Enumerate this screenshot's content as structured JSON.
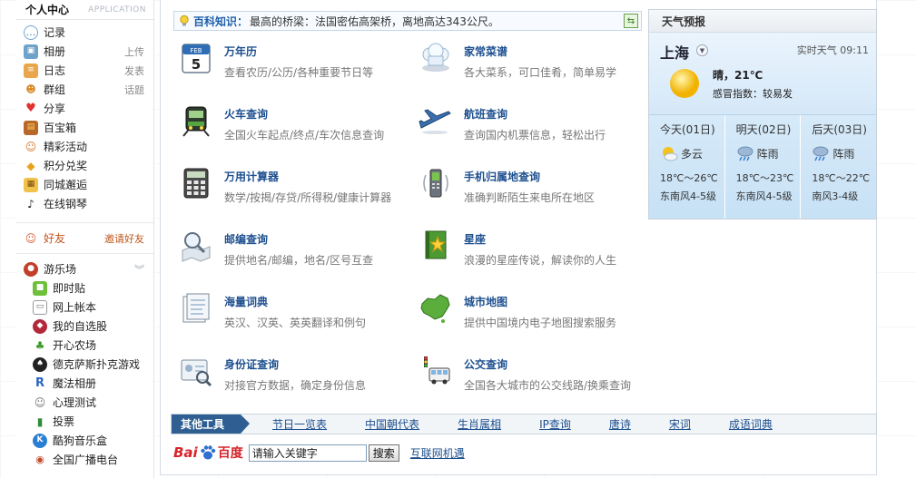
{
  "sidebar": {
    "title": "个人中心",
    "subtitle": "APPLICATION",
    "items": [
      {
        "label": "记录",
        "action": "",
        "icon": "speech-bubble-icon"
      },
      {
        "label": "相册",
        "action": "上传",
        "icon": "photo-icon"
      },
      {
        "label": "日志",
        "action": "发表",
        "icon": "notebook-icon"
      },
      {
        "label": "群组",
        "action": "话题",
        "icon": "group-icon"
      },
      {
        "label": "分享",
        "action": "",
        "icon": "heart-icon"
      },
      {
        "label": "百宝箱",
        "action": "",
        "icon": "treasure-box-icon"
      },
      {
        "label": "精彩活动",
        "action": "",
        "icon": "people-icon"
      },
      {
        "label": "积分兑奖",
        "action": "",
        "icon": "diamond-icon"
      },
      {
        "label": "同城邂逅",
        "action": "",
        "icon": "city-icon"
      },
      {
        "label": "在线钢琴",
        "action": "",
        "icon": "piano-icon"
      }
    ],
    "friends": {
      "label": "好友",
      "action": "邀请好友",
      "icon": "friend-icon"
    },
    "playground": {
      "label": "游乐场",
      "icon": "playground-icon"
    },
    "games": [
      {
        "label": "即时贴",
        "icon": "sticky-note-icon"
      },
      {
        "label": "网上帐本",
        "icon": "ledger-icon"
      },
      {
        "label": "我的自选股",
        "icon": "stock-icon"
      },
      {
        "label": "开心农场",
        "icon": "farm-sprout-icon"
      },
      {
        "label": "德克萨斯扑克游戏",
        "icon": "poker-icon"
      },
      {
        "label": "魔法相册",
        "icon": "magic-album-icon"
      },
      {
        "label": "心理测试",
        "icon": "psych-test-icon"
      },
      {
        "label": "投票",
        "icon": "vote-chart-icon"
      },
      {
        "label": "酷狗音乐盒",
        "icon": "kugou-music-icon"
      },
      {
        "label": "全国广播电台",
        "icon": "radio-icon"
      }
    ]
  },
  "tip": {
    "key": "百科知识：",
    "text": "最高的桥梁：法国密佑高架桥，离地高达343公尺。"
  },
  "tools": [
    {
      "name": "万年历",
      "desc": "查看农历/公历/各种重要节日等",
      "icon": "calendar-icon",
      "cal_month": "FEB",
      "cal_day": "5"
    },
    {
      "name": "家常菜谱",
      "desc": "各大菜系，可口佳肴，简单易学",
      "icon": "chef-hat-icon"
    },
    {
      "name": "火车查询",
      "desc": "全国火车起点/终点/车次信息查询",
      "icon": "train-icon"
    },
    {
      "name": "航班查询",
      "desc": "查询国内机票信息，轻松出行",
      "icon": "airplane-icon"
    },
    {
      "name": "万用计算器",
      "desc": "数学/按揭/存贷/所得税/健康计算器",
      "icon": "calculator-icon"
    },
    {
      "name": "手机归属地查询",
      "desc": "准确判断陌生来电所在地区",
      "icon": "mobile-phone-icon"
    },
    {
      "name": "邮编查询",
      "desc": "提供地名/邮编，地名/区号互查",
      "icon": "magnifier-map-icon"
    },
    {
      "name": "星座",
      "desc": "浪漫的星座传说，解读你的人生",
      "icon": "star-book-icon"
    },
    {
      "name": "海量词典",
      "desc": "英汉、汉英、英英翻译和例句",
      "icon": "dictionary-icon"
    },
    {
      "name": "城市地图",
      "desc": "提供中国境内电子地图搜索服务",
      "icon": "china-map-icon"
    },
    {
      "name": "身份证查询",
      "desc": "对接官方数据，确定身份信息",
      "icon": "id-card-icon"
    },
    {
      "name": "公交查询",
      "desc": "全国各大城市的公交线路/换乘查询",
      "icon": "bus-icon"
    }
  ],
  "weather": {
    "title": "天气预报",
    "city": "上海",
    "realtime_label": "实时天气 09:11",
    "condition": "晴，21℃",
    "feel": "感冒指数：较易发",
    "days": [
      {
        "label": "今天(01日)",
        "cond": "多云",
        "temp": "18℃～26℃",
        "wind": "东南风4-5级",
        "icon": "partly-cloudy-icon"
      },
      {
        "label": "明天(02日)",
        "cond": "阵雨",
        "temp": "18℃～23℃",
        "wind": "东南风4-5级",
        "icon": "shower-icon"
      },
      {
        "label": "后天(03日)",
        "cond": "阵雨",
        "temp": "18℃～22℃",
        "wind": "南风3-4级",
        "icon": "shower-icon"
      }
    ]
  },
  "tabs": {
    "first": "其他工具",
    "links": [
      "节日一览表",
      "中国朝代表",
      "生肖属相",
      "IP查询",
      "唐诗",
      "宋词",
      "成语词典"
    ]
  },
  "search": {
    "brand_latin": "Bai",
    "brand_cn": "百度",
    "input_value": "请输入关键字",
    "button": "搜索",
    "link": "互联网机遇"
  },
  "colors": {
    "link": "#1d4f8f",
    "tab_active": "#2f5f92",
    "friends": "#c0561b",
    "weather_bg": "#d6eaf9"
  }
}
